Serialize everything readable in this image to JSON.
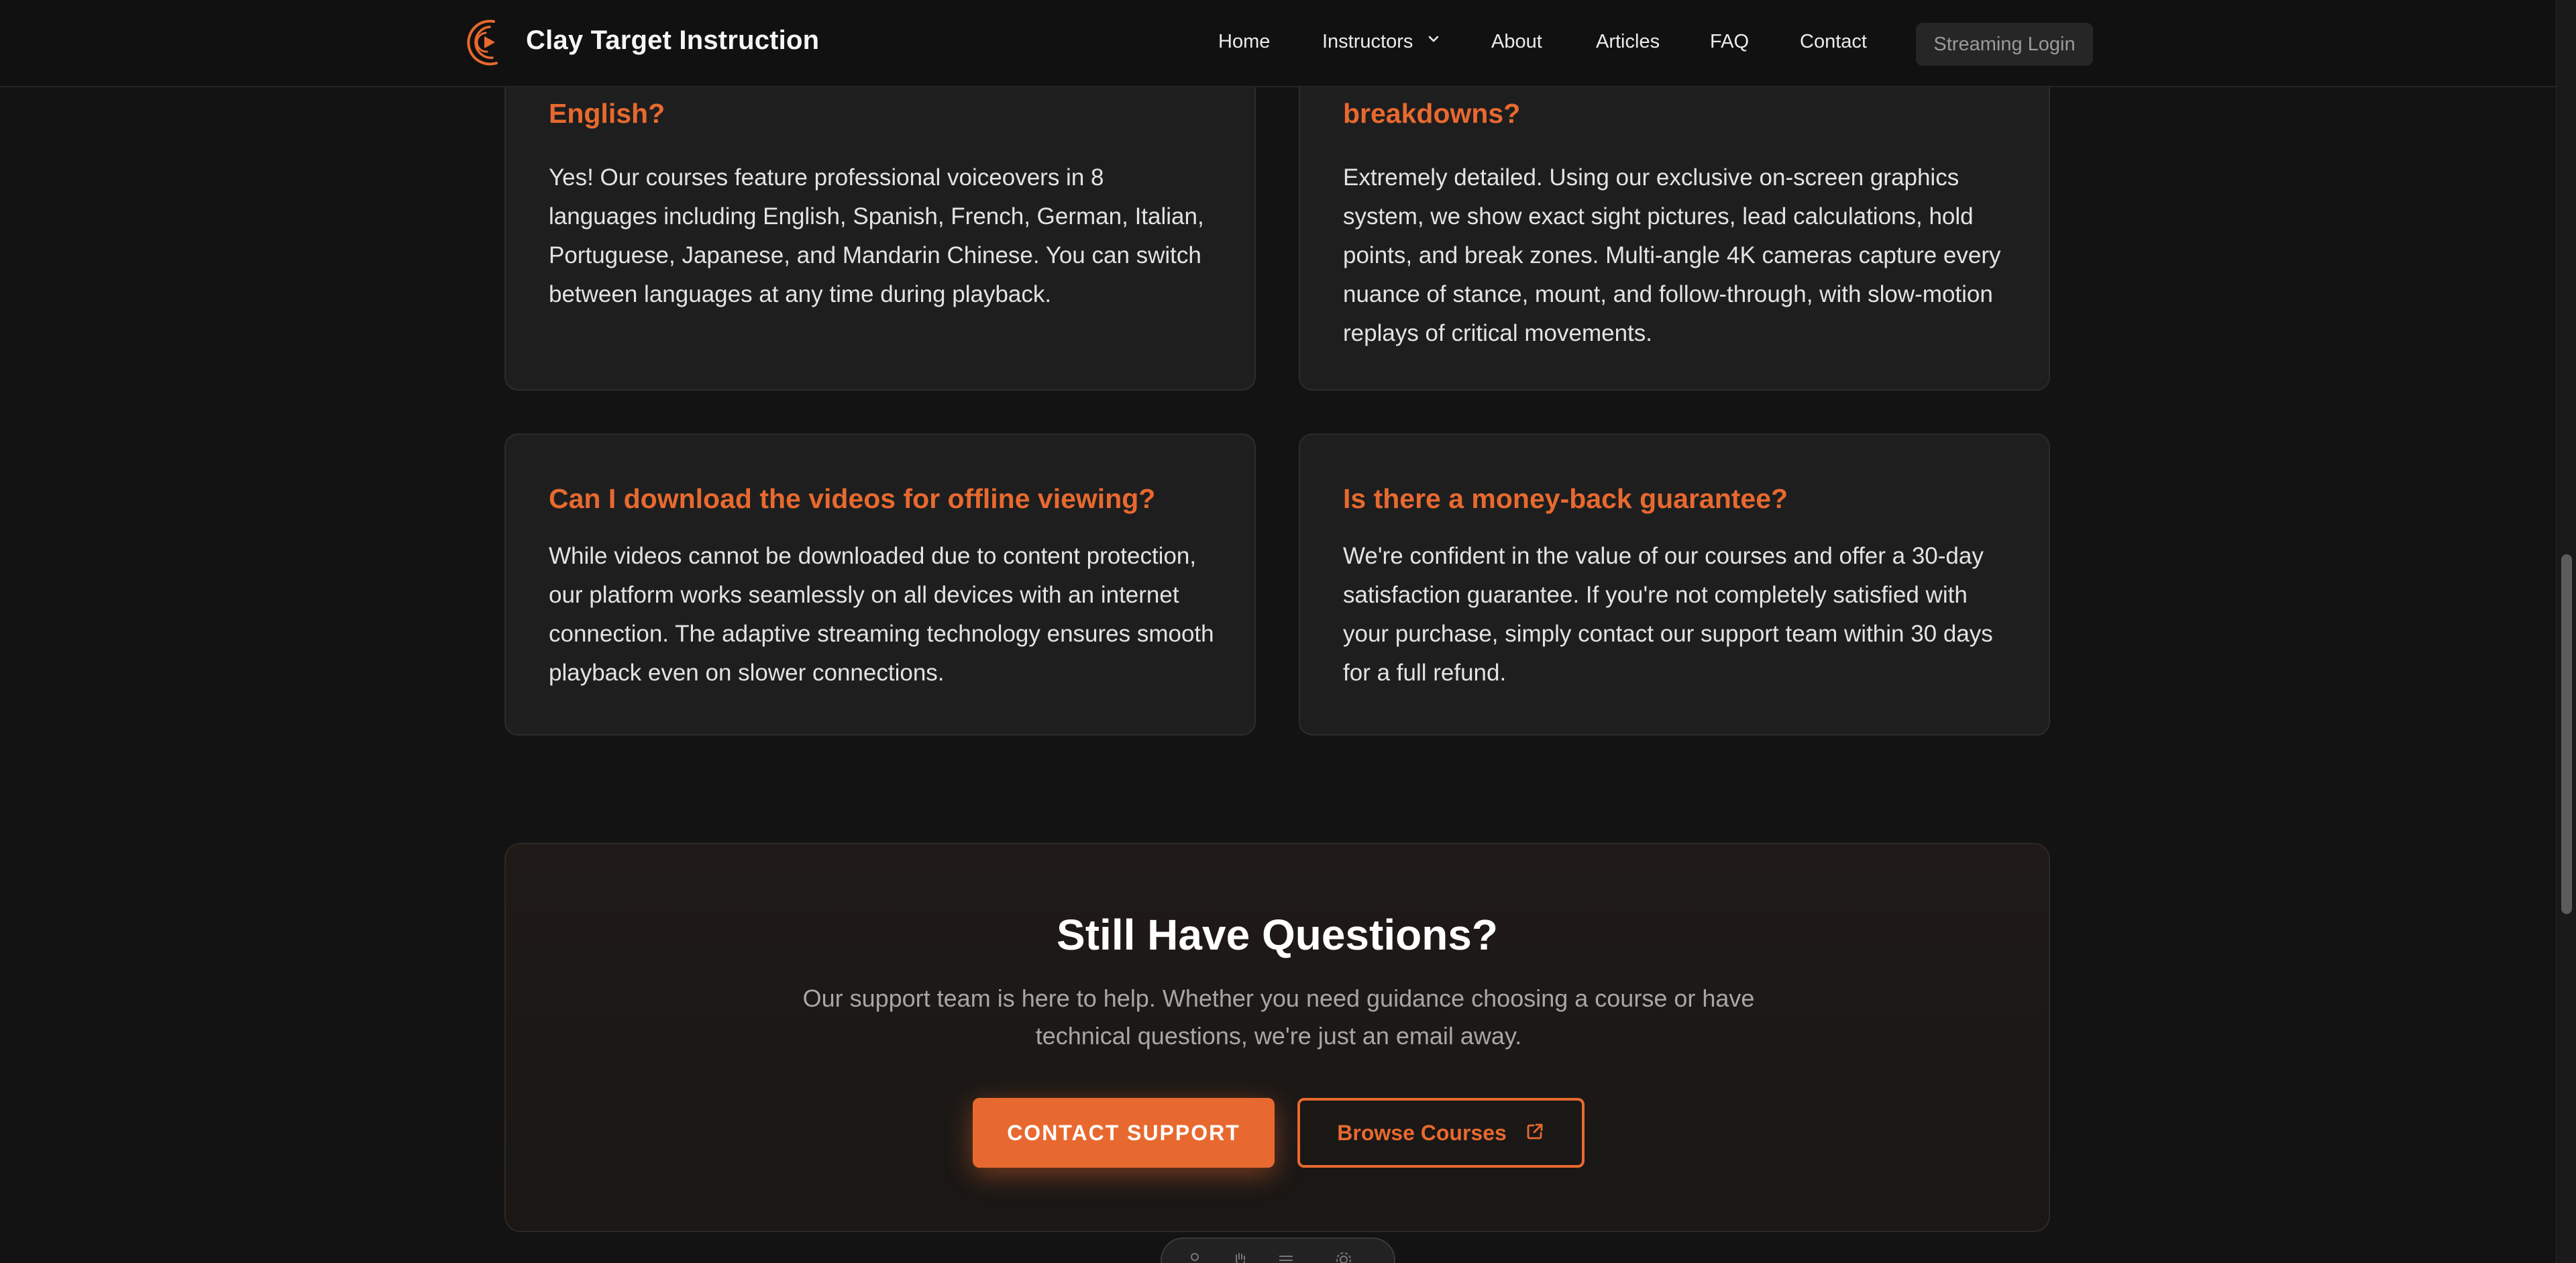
{
  "header": {
    "brand": "Clay Target Instruction",
    "nav": [
      {
        "label": "Home"
      },
      {
        "label": "Instructors"
      },
      {
        "label": "About"
      },
      {
        "label": "Articles"
      },
      {
        "label": "FAQ"
      },
      {
        "label": "Contact"
      }
    ],
    "login_label": "Streaming Login"
  },
  "faq": [
    {
      "question": "English?",
      "answer": "Yes! Our courses feature professional voiceovers in 8 languages including English, Spanish, French, German, Italian, Portuguese, Japanese, and Mandarin Chinese. You can switch between languages at any time during playback."
    },
    {
      "question": "breakdowns?",
      "answer": "Extremely detailed. Using our exclusive on-screen graphics system, we show exact sight pictures, lead calculations, hold points, and break zones. Multi-angle 4K cameras capture every nuance of stance, mount, and follow-through, with slow-motion replays of critical movements."
    },
    {
      "question": "Can I download the videos for offline viewing?",
      "answer": "While videos cannot be downloaded due to content protection, our platform works seamlessly on all devices with an internet connection. The adaptive streaming technology ensures smooth playback even on slower connections."
    },
    {
      "question": "Is there a money-back guarantee?",
      "answer": "We're confident in the value of our courses and offer a 30-day satisfaction guarantee. If you're not completely satisfied with your purchase, simply contact our support team within 30 days for a full refund."
    }
  ],
  "cta": {
    "title": "Still Have Questions?",
    "text": "Our support team is here to help. Whether you need guidance choosing a course or have technical questions, we're just an email away.",
    "primary_label": "CONTACT SUPPORT",
    "secondary_label": "Browse Courses"
  },
  "colors": {
    "accent": "#e8692f",
    "background": "#131313",
    "card": "#1e1e1e"
  },
  "icons": {
    "logo": "play-swoosh-logo-icon",
    "nav_dropdown": "chevron-down-icon",
    "external": "external-link-icon"
  }
}
